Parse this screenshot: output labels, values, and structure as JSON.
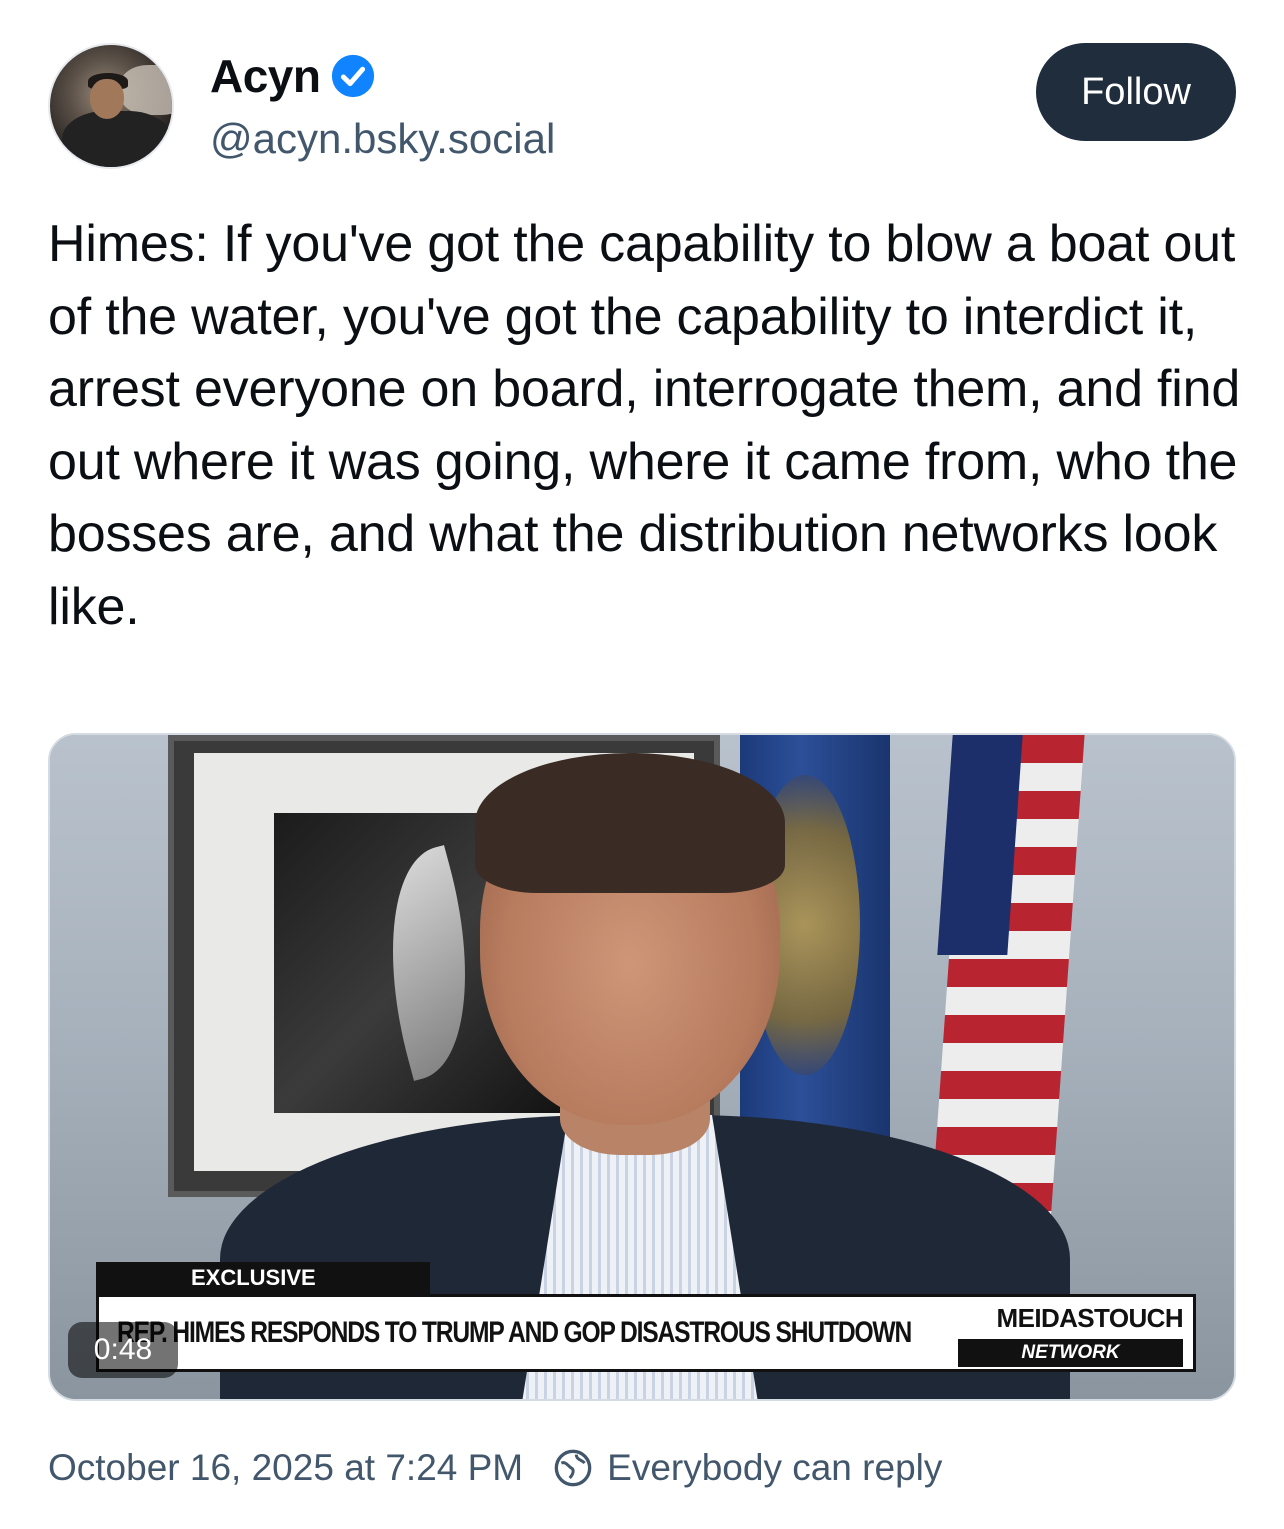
{
  "author": {
    "display_name": "Acyn",
    "handle": "@acyn.bsky.social",
    "verified_icon": "verified-check-icon",
    "avatar_icon": "avatar-photo"
  },
  "follow_button": {
    "label": "Follow"
  },
  "post": {
    "text": "Himes: If you've got the capability to blow a boat out of the water, you've got the capability to interdict it, arrest everyone on board, interrogate them, and find out where it was going, where it came from, who the bosses are, and what the distribution networks look like."
  },
  "video": {
    "duration": "0:48",
    "lower_third": {
      "tag": "EXCLUSIVE",
      "headline": "REP. HIMES RESPONDS TO TRUMP AND GOP DISASTROUS SHUTDOWN",
      "brand_top": "MEIDASTOUCH",
      "brand_bottom": "NETWORK"
    }
  },
  "footer": {
    "timestamp": "October 16, 2025 at 7:24 PM",
    "reply_setting": "Everybody can reply",
    "reply_icon": "globe-reply-icon"
  },
  "colors": {
    "accent": "#1083fe",
    "follow_bg": "#1f2d3d",
    "muted_text": "#42576c"
  }
}
